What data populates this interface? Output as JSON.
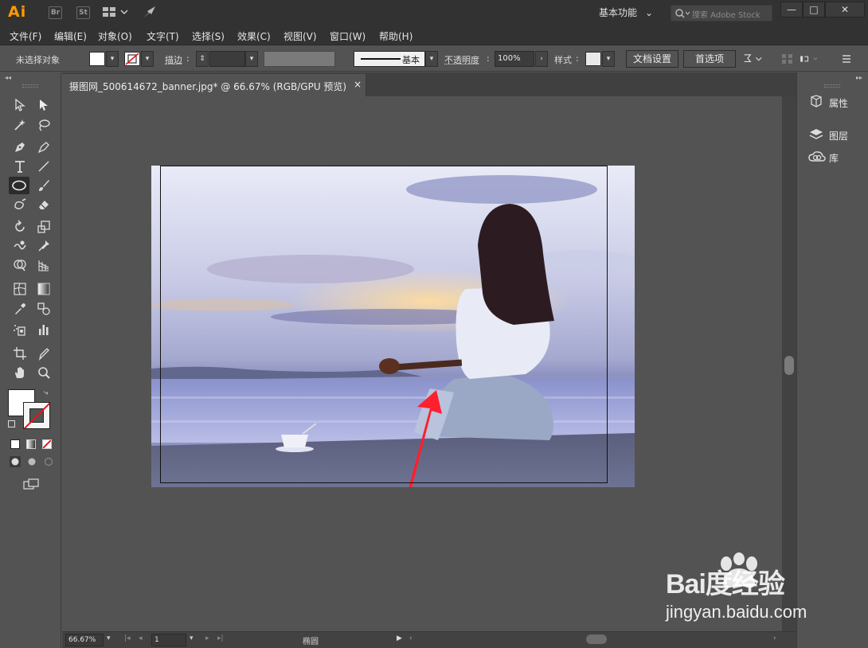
{
  "app": {
    "logo": "Ai",
    "badges": [
      "Br",
      "St"
    ],
    "workspace": "基本功能",
    "search_placeholder": "搜索 Adobe Stock",
    "window_controls": [
      "—",
      "□",
      "✕"
    ]
  },
  "menu": [
    "文件(F)",
    "编辑(E)",
    "对象(O)",
    "文字(T)",
    "选择(S)",
    "效果(C)",
    "视图(V)",
    "窗口(W)",
    "帮助(H)"
  ],
  "control_bar": {
    "selection_status": "未选择对象",
    "stroke_label": "描边",
    "stroke_preset": "基本",
    "opacity_label": "不透明度",
    "opacity_value": "100%",
    "style_label": "样式",
    "doc_setup_button": "文档设置",
    "preferences_button": "首选项"
  },
  "document": {
    "tab_title": "摄图网_500614672_banner.jpg* @ 66.67% (RGB/GPU 预览)",
    "close": "×"
  },
  "right_panel": {
    "items": [
      "属性",
      "图层",
      "库"
    ]
  },
  "status_bar": {
    "zoom": "66.67%",
    "page": "1",
    "current_tool": "椭圆"
  },
  "watermark": {
    "brand": "Bai度经验",
    "url": "jingyan.baidu.com"
  },
  "colors": {
    "annotation_arrow": "#ff1f2f",
    "app_logo": "#ff9a00"
  }
}
